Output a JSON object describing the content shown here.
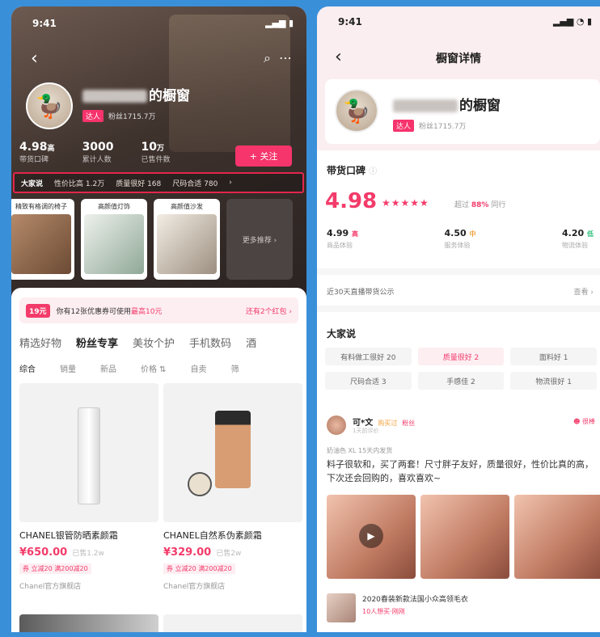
{
  "left": {
    "status_time": "9:41",
    "status_right": "▂▄▆ ▮",
    "shop": {
      "name_suffix": "的橱窗",
      "tag": "达人",
      "fans": "粉丝1715.7万"
    },
    "stats": [
      {
        "value": "4.98",
        "unit": "高",
        "label": "带货口碑"
      },
      {
        "value": "3000",
        "unit": "",
        "label": "累计人数"
      },
      {
        "value": "10",
        "unit": "万",
        "label": "已售件数"
      }
    ],
    "follow_label": "+ 关注",
    "ratings_bar": [
      "大家说",
      "性价比高 1.2万",
      "质量很好 168",
      "尺码合适 780",
      "›"
    ],
    "cards": [
      {
        "title": "精致有格调的椅子"
      },
      {
        "title": "高颜值灯饰"
      },
      {
        "title": "高颜值沙发"
      },
      {
        "title": "更多推荐 ›"
      }
    ],
    "coupon": {
      "badge": "19元",
      "text": "你有12张优惠券可使用",
      "highlight": "最高10元",
      "link": "还有2个红包 ›"
    },
    "tabs": [
      "精选好物",
      "粉丝专享",
      "美妆个护",
      "手机数码",
      "酒"
    ],
    "filters": [
      "综合",
      "销量",
      "新品",
      "价格 ⇅",
      "自卖",
      "筛"
    ],
    "products": [
      {
        "name": "CHANEL银管防晒素颜霜",
        "price": "¥650.00",
        "sold": "已售1.2w",
        "promo": "券 立减20  满200减20",
        "shop": "Chanel官方旗舰店"
      },
      {
        "name": "CHANEL自然系伪素颜霜",
        "price": "¥329.00",
        "sold": "已售2w",
        "promo": "券 立减20  满200减20",
        "shop": "Chanel官方旗舰店"
      }
    ]
  },
  "right": {
    "status_time": "9:41",
    "status_right": "▂▄▆ ◔ ▮",
    "title": "橱窗详情",
    "shop": {
      "name_suffix": "的橱窗",
      "tag": "达人",
      "fans": "粉丝1715.7万"
    },
    "reputation": {
      "heading": "带货口碑",
      "score": "4.98",
      "stars": "★★★★★",
      "beat_prefix": "超过",
      "beat_pct": "88%",
      "beat_suffix": "同行",
      "subs": [
        {
          "value": "4.99",
          "arrow": "高",
          "label": "商品体验",
          "color": "#f33b6a"
        },
        {
          "value": "4.50",
          "arrow": "中",
          "label": "服务体验",
          "color": "#f3a03b"
        },
        {
          "value": "4.20",
          "arrow": "低",
          "label": "物流体验",
          "color": "#2bbf7a"
        }
      ]
    },
    "public_notice": {
      "text": "近30天直播带货公示",
      "link": "查看 ›"
    },
    "everyone": {
      "heading": "大家说",
      "chips": [
        "有料做工很好 20",
        "质量很好 2",
        "面料好 1",
        "尺码合适 3",
        "手感佳 2",
        "物流很好 1"
      ]
    },
    "review": {
      "name": "可*文",
      "tag1": "购买过",
      "tag2": "粉丝",
      "date": "1天前评价",
      "badge": "很棒",
      "spec": "奶油色 XL 15天内发货",
      "text": "料子很软和，买了两套！尺寸胖子友好，质量很好，性价比真的高，下次还会回购的，喜欢喜欢~"
    },
    "live": {
      "title": "2020春装新款法国小众高领毛衣",
      "sub": "10人想买·刚刚"
    }
  }
}
